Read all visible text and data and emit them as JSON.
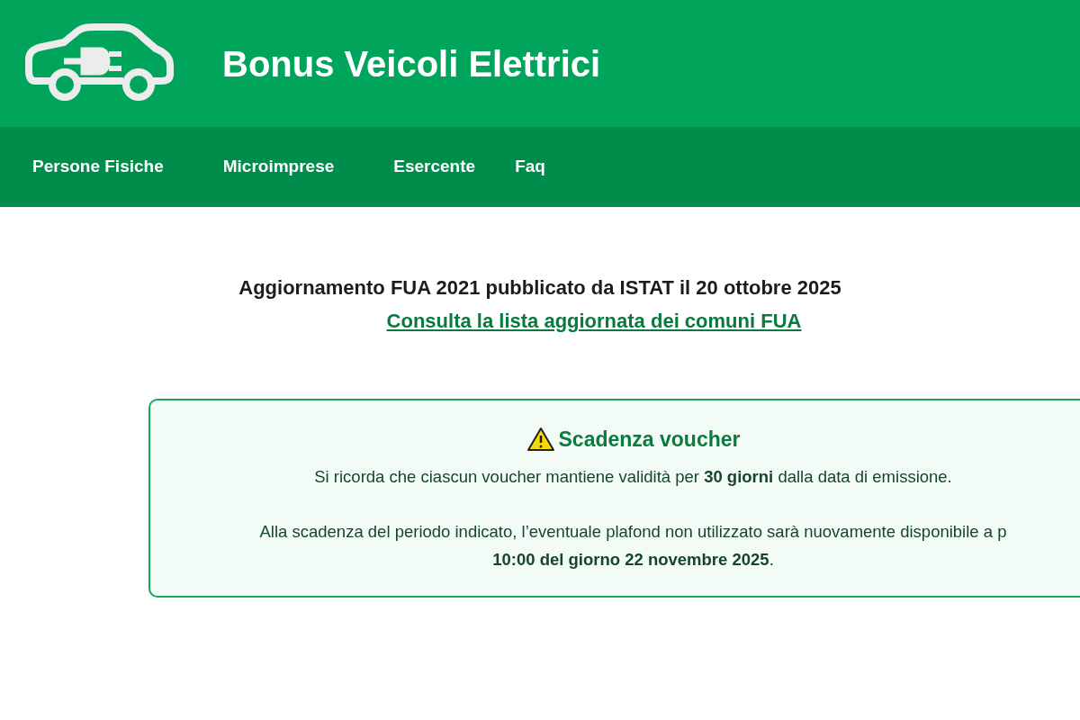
{
  "header": {
    "title": "Bonus Veicoli Elettrici"
  },
  "nav": {
    "items": [
      "Persone Fisiche",
      "Microimprese",
      "Esercente",
      "Faq"
    ]
  },
  "notice": {
    "text": "Aggiornamento FUA 2021 pubblicato da ISTAT il 20 ottobre 2025",
    "link": "Consulta la lista aggiornata dei comuni FUA"
  },
  "alert": {
    "title": "Scadenza voucher",
    "paragraphs": [
      [
        "Si ricorda che ciascun voucher mantiene validità per **30 giorni** dalla data di emissione."
      ],
      [
        "Alla scadenza del periodo indicato, l’eventuale plafond non utilizzato sarà nuovamente disponibile a p",
        "**10:00 del giorno 22 novembre 2025**."
      ]
    ]
  }
}
